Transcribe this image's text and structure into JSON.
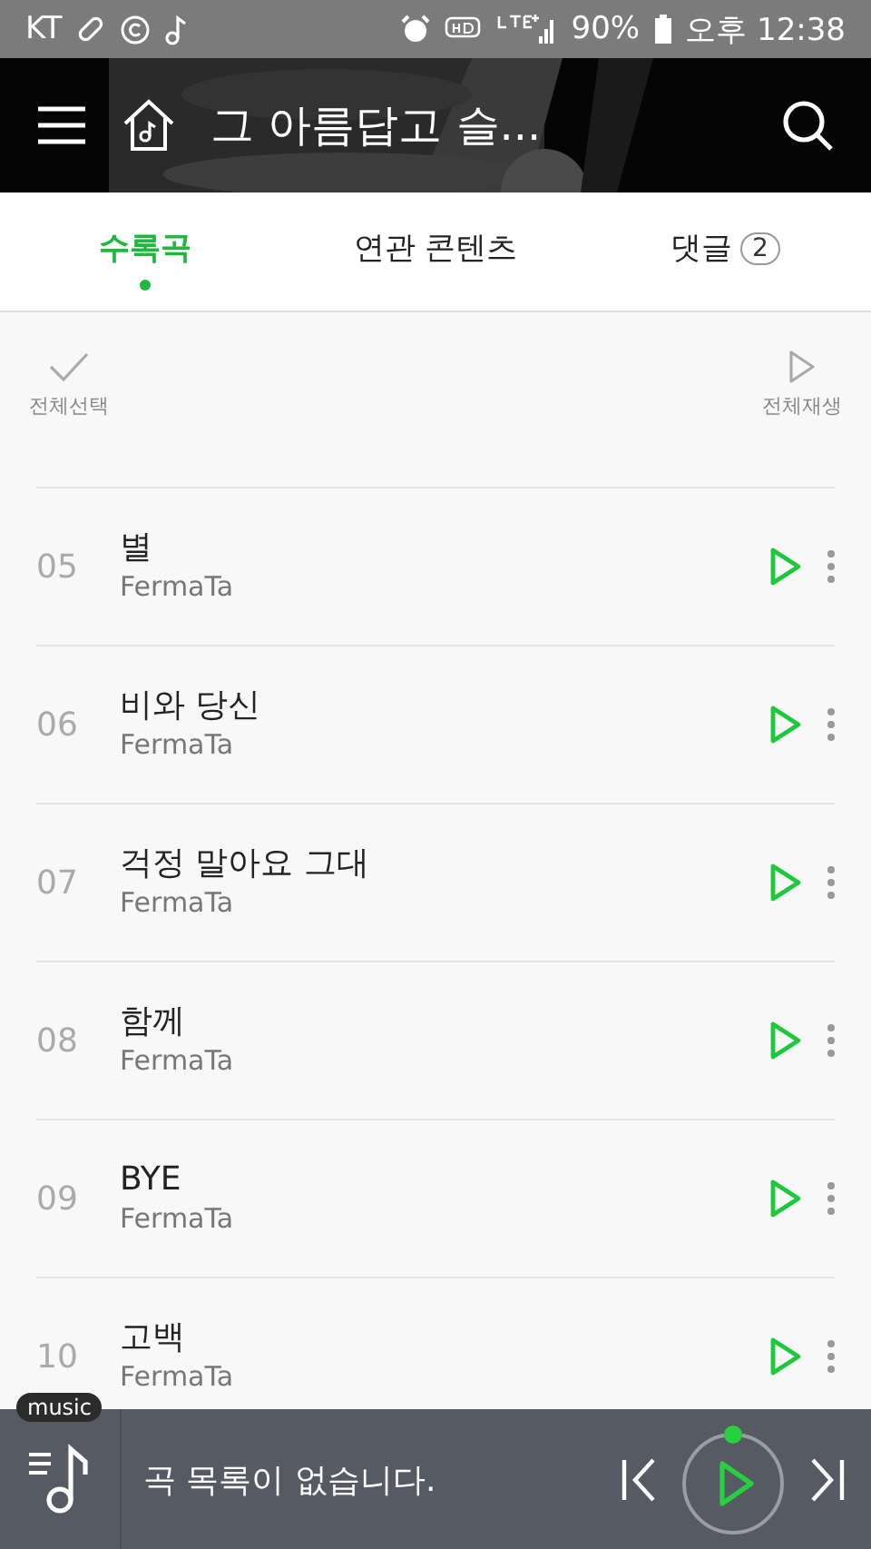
{
  "status_bar": {
    "carrier": "KT",
    "battery": "90%",
    "time": "오후 12:38"
  },
  "header": {
    "title": "그 아름답고 슬..."
  },
  "tabs": [
    {
      "label": "수록곡",
      "selected": true
    },
    {
      "label": "연관 콘텐츠",
      "selected": false
    },
    {
      "label": "댓글",
      "count": "2",
      "selected": false
    }
  ],
  "toolbar": {
    "select_all": "전체선택",
    "play_all": "전체재생"
  },
  "tracks": [
    {
      "number": "05",
      "title": "별",
      "artist": "FermaTa"
    },
    {
      "number": "06",
      "title": "비와 당신",
      "artist": "FermaTa"
    },
    {
      "number": "07",
      "title": "걱정 말아요 그대",
      "artist": "FermaTa"
    },
    {
      "number": "08",
      "title": "함께",
      "artist": "FermaTa"
    },
    {
      "number": "09",
      "title": "BYE",
      "artist": "FermaTa"
    },
    {
      "number": "10",
      "title": "고백",
      "artist": "FermaTa"
    }
  ],
  "player": {
    "badge": "music",
    "message": "곡 목록이 없습니다."
  }
}
